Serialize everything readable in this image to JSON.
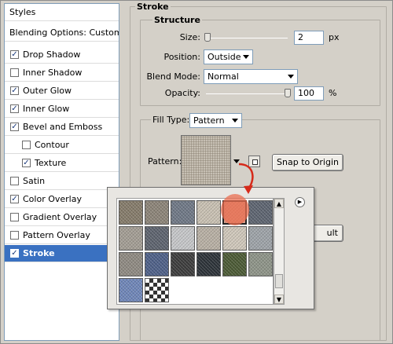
{
  "styles_list": {
    "header": "Styles",
    "blending_options": "Blending Options: Custom",
    "items": [
      {
        "label": "Drop Shadow",
        "checked": true,
        "sub": false
      },
      {
        "label": "Inner Shadow",
        "checked": false,
        "sub": false
      },
      {
        "label": "Outer Glow",
        "checked": true,
        "sub": false
      },
      {
        "label": "Inner Glow",
        "checked": true,
        "sub": false
      },
      {
        "label": "Bevel and Emboss",
        "checked": true,
        "sub": false
      },
      {
        "label": "Contour",
        "checked": false,
        "sub": true
      },
      {
        "label": "Texture",
        "checked": true,
        "sub": true
      },
      {
        "label": "Satin",
        "checked": false,
        "sub": false
      },
      {
        "label": "Color Overlay",
        "checked": true,
        "sub": false
      },
      {
        "label": "Gradient Overlay",
        "checked": false,
        "sub": false
      },
      {
        "label": "Pattern Overlay",
        "checked": false,
        "sub": false
      },
      {
        "label": "Stroke",
        "checked": true,
        "sub": false,
        "selected": true
      }
    ]
  },
  "stroke": {
    "title": "Stroke",
    "structure_title": "Structure",
    "size_label": "Size:",
    "size_value": "2",
    "size_unit": "px",
    "size_level": 0.02,
    "position_label": "Position:",
    "position_value": "Outside",
    "blend_label": "Blend Mode:",
    "blend_value": "Normal",
    "opacity_label": "Opacity:",
    "opacity_value": "100",
    "opacity_unit": "%",
    "opacity_level": 1.0,
    "fill_type_label": "Fill Type:",
    "fill_type_value": "Pattern",
    "pattern_label": "Pattern:",
    "snap_button": "Snap to Origin",
    "partial_button_text": "ult"
  },
  "pattern_picker": {
    "menu_icon": "play-arrow-icon",
    "tiles": [
      "#857b6a",
      "#8c8478",
      "#6f7886",
      "#c9c1b3",
      "#d9a08a",
      "#5d6470",
      "#a39d94",
      "#5d636e",
      "#c6c7c9",
      "#b8b0a4",
      "#d0c8bb",
      "#9ea3a8",
      "#8f8a82",
      "#4e6088",
      "#3c3c3c",
      "#2c3238",
      "#4b5a35",
      "#8e9488",
      "#6f86b8",
      "#ffffff"
    ]
  },
  "colors": {
    "accent_selected": "#3a71c1",
    "highlight": "#e65a3c",
    "arrow": "#d62a1a"
  }
}
